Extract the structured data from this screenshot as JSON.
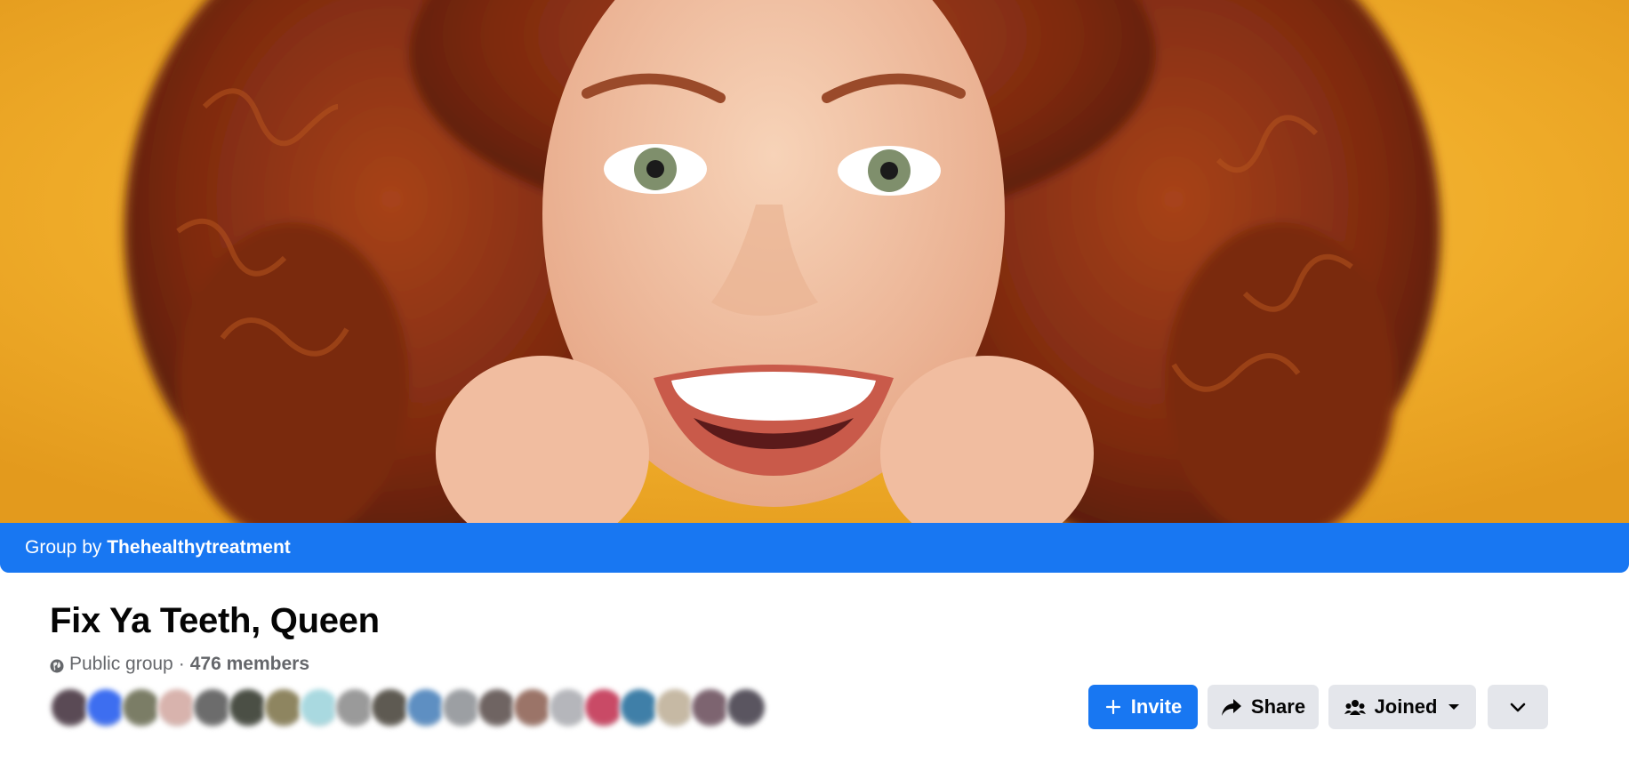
{
  "cover": {
    "background_color": "#f0ad2a",
    "hair_color": "#8a2e10",
    "skin_color": "#f2c3a4"
  },
  "group_by": {
    "prefix": "Group by",
    "owner": "Thehealthytreatment",
    "bar_color": "#1877f2"
  },
  "group": {
    "title": "Fix Ya Teeth, Queen",
    "privacy_icon": "globe-icon",
    "privacy": "Public group",
    "separator": "·",
    "members": "476 members"
  },
  "avatars": {
    "colors": [
      "#5a4a55",
      "#3d6ef0",
      "#7b7d66",
      "#d8b3ad",
      "#6c6c6c",
      "#4b4f45",
      "#8e8560",
      "#a9d9e0",
      "#9a9a9a",
      "#5e5a52",
      "#5e8fc2",
      "#9c9fa3",
      "#6f6462",
      "#9b7468",
      "#b5b6bb",
      "#c94a66",
      "#3f7fa8",
      "#c6b9a4",
      "#7d6470",
      "#5a5560"
    ]
  },
  "actions": {
    "invite_label": "Invite",
    "invite_icon": "plus-icon",
    "share_label": "Share",
    "share_icon": "share-arrow-icon",
    "joined_label": "Joined",
    "joined_icon": "members-icon",
    "joined_caret_icon": "caret-down-icon",
    "more_icon": "chevron-down-icon",
    "primary_color": "#1877f2",
    "secondary_color": "#e4e6eb"
  }
}
